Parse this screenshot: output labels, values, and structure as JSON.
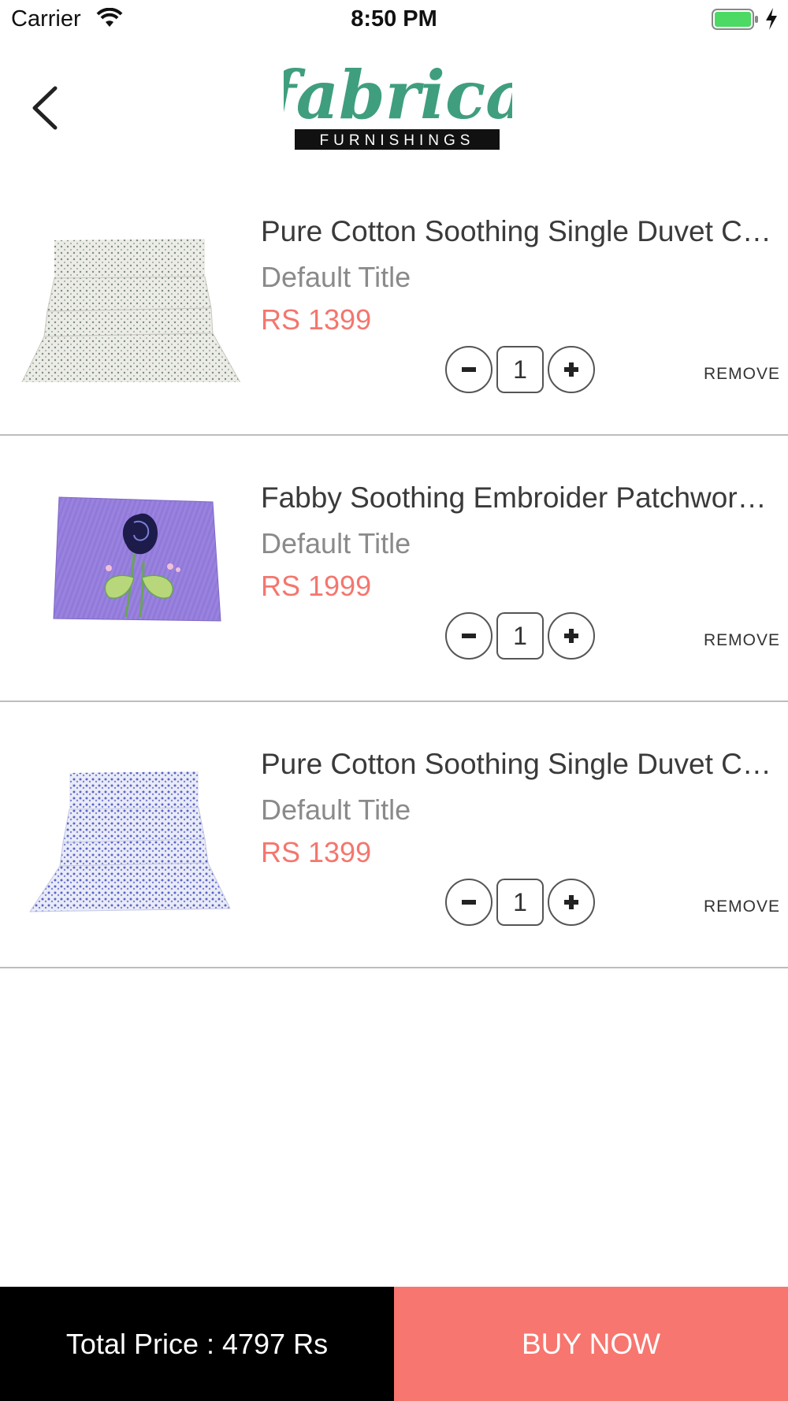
{
  "status_bar": {
    "carrier": "Carrier",
    "time": "8:50 PM",
    "battery_color": "#4cd964"
  },
  "nav": {
    "back_icon": "chevron-left-icon",
    "logo": {
      "word": "fabrica",
      "tagline": "FURNISHINGS",
      "brand_color": "#3f9e7e"
    }
  },
  "cart": {
    "items": [
      {
        "title": "Pure Cotton Soothing Single Duvet Cover",
        "variant": "Default Title",
        "price_prefix": "RS",
        "price": "1399",
        "quantity": "1",
        "remove_label": "REMOVE",
        "image_name": "white-floral-duvet-image"
      },
      {
        "title": "Fabby Soothing Embroider Patchwork Cushion Cover",
        "variant": "Default Title",
        "price_prefix": "RS",
        "price": "1999",
        "quantity": "1",
        "remove_label": "REMOVE",
        "image_name": "purple-rose-embroidery-image"
      },
      {
        "title": "Pure Cotton Soothing Single Duvet Cover",
        "variant": "Default Title",
        "price_prefix": "RS",
        "price": "1399",
        "quantity": "1",
        "remove_label": "REMOVE",
        "image_name": "blue-floral-duvet-image"
      }
    ]
  },
  "footer": {
    "total_label": "Total Price : 4797 Rs",
    "buy_label": "BUY NOW"
  },
  "colors": {
    "accent": "#f7766f",
    "price": "#f4766e",
    "footer_left": "#000000"
  }
}
